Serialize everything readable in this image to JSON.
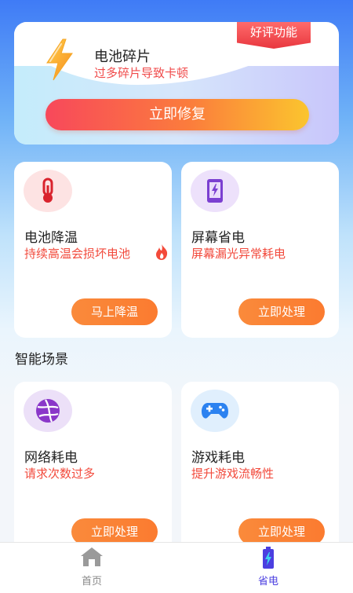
{
  "top_card": {
    "badge": "好评功能",
    "title": "电池碎片",
    "subtitle": "过多碎片导致卡顿",
    "button": "立即修复",
    "icon": "lightning-bolt-icon"
  },
  "cards": [
    {
      "title": "电池降温",
      "desc": "持续高温会损坏电池",
      "button": "马上降温",
      "icon": "thermometer-icon",
      "icon_bg": "#fde3e3",
      "has_flame": true
    },
    {
      "title": "屏幕省电",
      "desc": "屏幕漏光异常耗电",
      "button": "立即处理",
      "icon": "phone-charging-icon",
      "icon_bg": "#ede1fb"
    },
    {
      "title": "网络耗电",
      "desc": "请求次数过多",
      "button": "立即处理",
      "icon": "globe-icon",
      "icon_bg": "#ece0f8"
    },
    {
      "title": "游戏耗电",
      "desc": "提升游戏流畅性",
      "button": "立即处理",
      "icon": "gamepad-icon",
      "icon_bg": "#e0effd"
    }
  ],
  "section": {
    "scenes_title": "智能场景"
  },
  "tabbar": {
    "items": [
      {
        "label": "首页",
        "icon": "home-icon",
        "active": false
      },
      {
        "label": "省电",
        "icon": "battery-icon",
        "active": true
      }
    ]
  },
  "colors": {
    "accent_orange": "#fb7b30",
    "warning_red": "#f24a3c",
    "active_tab": "#4b3fe0",
    "inactive_tab": "#888888"
  }
}
